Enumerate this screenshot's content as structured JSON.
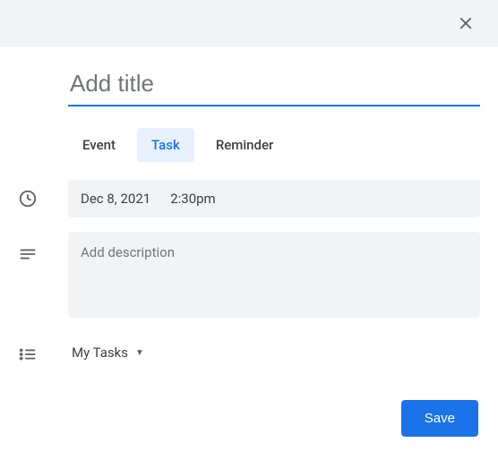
{
  "title_placeholder": "Add title",
  "title_value": "",
  "tabs": {
    "event": "Event",
    "task": "Task",
    "reminder": "Reminder",
    "active": "task"
  },
  "datetime": {
    "date": "Dec 8, 2021",
    "time": "2:30pm"
  },
  "description_placeholder": "Add description",
  "description_value": "",
  "task_list": {
    "selected": "My Tasks"
  },
  "save_label": "Save"
}
